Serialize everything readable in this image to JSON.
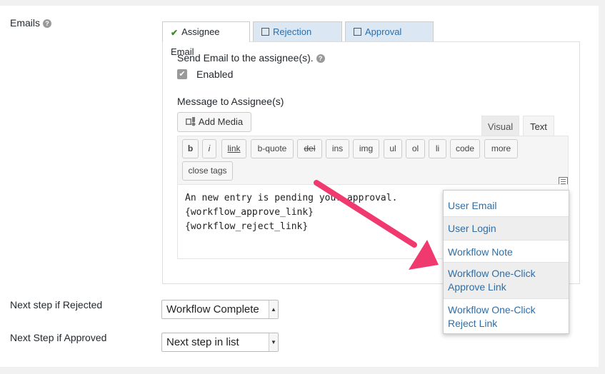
{
  "labels": {
    "emails": "Emails",
    "next_step_rejected": "Next step if Rejected",
    "next_step_approved": "Next Step if Approved"
  },
  "tabs": [
    {
      "label": "Assignee Email",
      "active": true
    },
    {
      "label": "Rejection Email",
      "active": false
    },
    {
      "label": "Approval Email",
      "active": false
    }
  ],
  "send_email": {
    "label": "Send Email to the assignee(s).",
    "checkbox_label": "Enabled",
    "checked": true
  },
  "message": {
    "label": "Message to Assignee(s)",
    "add_media_label": "Add Media",
    "editor_tabs": [
      "Visual",
      "Text"
    ],
    "active_editor_tab": "Text",
    "quicktags": [
      "b",
      "i",
      "link",
      "b-quote",
      "del",
      "ins",
      "img",
      "ul",
      "ol",
      "li",
      "code",
      "more",
      "close tags"
    ],
    "content_lines": [
      "An new entry is pending your approval.",
      "{workflow_approve_link}",
      "{workflow_reject_link}"
    ]
  },
  "merge_tags": [
    {
      "label": "User Email"
    },
    {
      "label": "User Login"
    },
    {
      "label": "Workflow Note"
    },
    {
      "label_line1": "Workflow One-Click",
      "label_line2": "Approve Link"
    },
    {
      "label_line1": "Workflow One-Click",
      "label_line2": "Reject Link"
    }
  ],
  "selects": {
    "rejected_value": "Workflow Complete",
    "approved_value": "Next step in list"
  },
  "colors": {
    "arrow": "#f0396e",
    "link": "#2e6ea6",
    "inactive_tab_bg": "#dbe8f3"
  }
}
